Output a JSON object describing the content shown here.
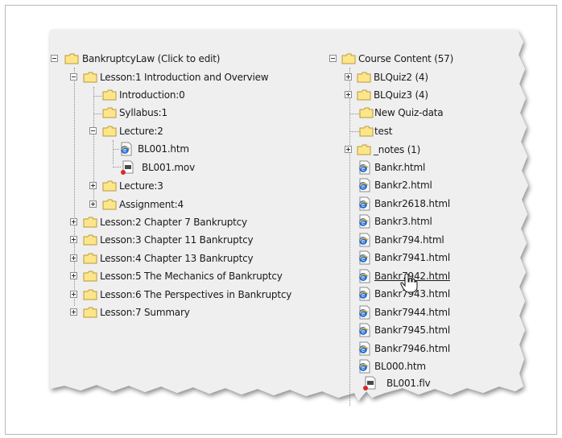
{
  "left_tree": {
    "root": "BankruptcyLaw (Click to edit)",
    "lesson1": "Lesson:1 Introduction and Overview",
    "introduction": "Introduction:0",
    "syllabus": "Syllabus:1",
    "lecture2": "Lecture:2",
    "bl001_htm": "BL001.htm",
    "bl001_mov": "BL001.mov",
    "lecture3": "Lecture:3",
    "assignment4": "Assignment:4",
    "lesson2": "Lesson:2 Chapter 7 Bankruptcy",
    "lesson3": "Lesson:3 Chapter 11 Bankruptcy",
    "lesson4": "Lesson:4 Chapter 13 Bankruptcy",
    "lesson5": "Lesson:5 The Mechanics of Bankruptcy",
    "lesson6": "Lesson:6 The Perspectives in Bankruptcy",
    "lesson7": "Lesson:7 Summary"
  },
  "right_tree": {
    "root": "Course Content (57)",
    "blquiz2": "BLQuiz2 (4)",
    "blquiz3": "BLQuiz3 (4)",
    "new_quiz": "New Quiz-data",
    "test": "test",
    "notes": "_notes (1)",
    "files": [
      "Bankr.html",
      "Bankr2.html",
      "Bankr2618.html",
      "Bankr3.html",
      "Bankr794.html",
      "Bankr7941.html",
      "Bankr7942.html",
      "Bankr7943.html",
      "Bankr7944.html",
      "Bankr7945.html",
      "Bankr7946.html",
      "BL000.htm"
    ],
    "bl001_flv": "BL001.flv"
  },
  "colors": {
    "panel": "#efefef",
    "folder": "#fde58a",
    "folder_edge": "#b99a3b",
    "ie_blue": "#2a6fd3"
  },
  "icons": [
    "folder-icon",
    "html-page-icon",
    "video-file-icon",
    "hand-cursor-icon",
    "expand-toggle-icon",
    "collapse-toggle-icon"
  ]
}
